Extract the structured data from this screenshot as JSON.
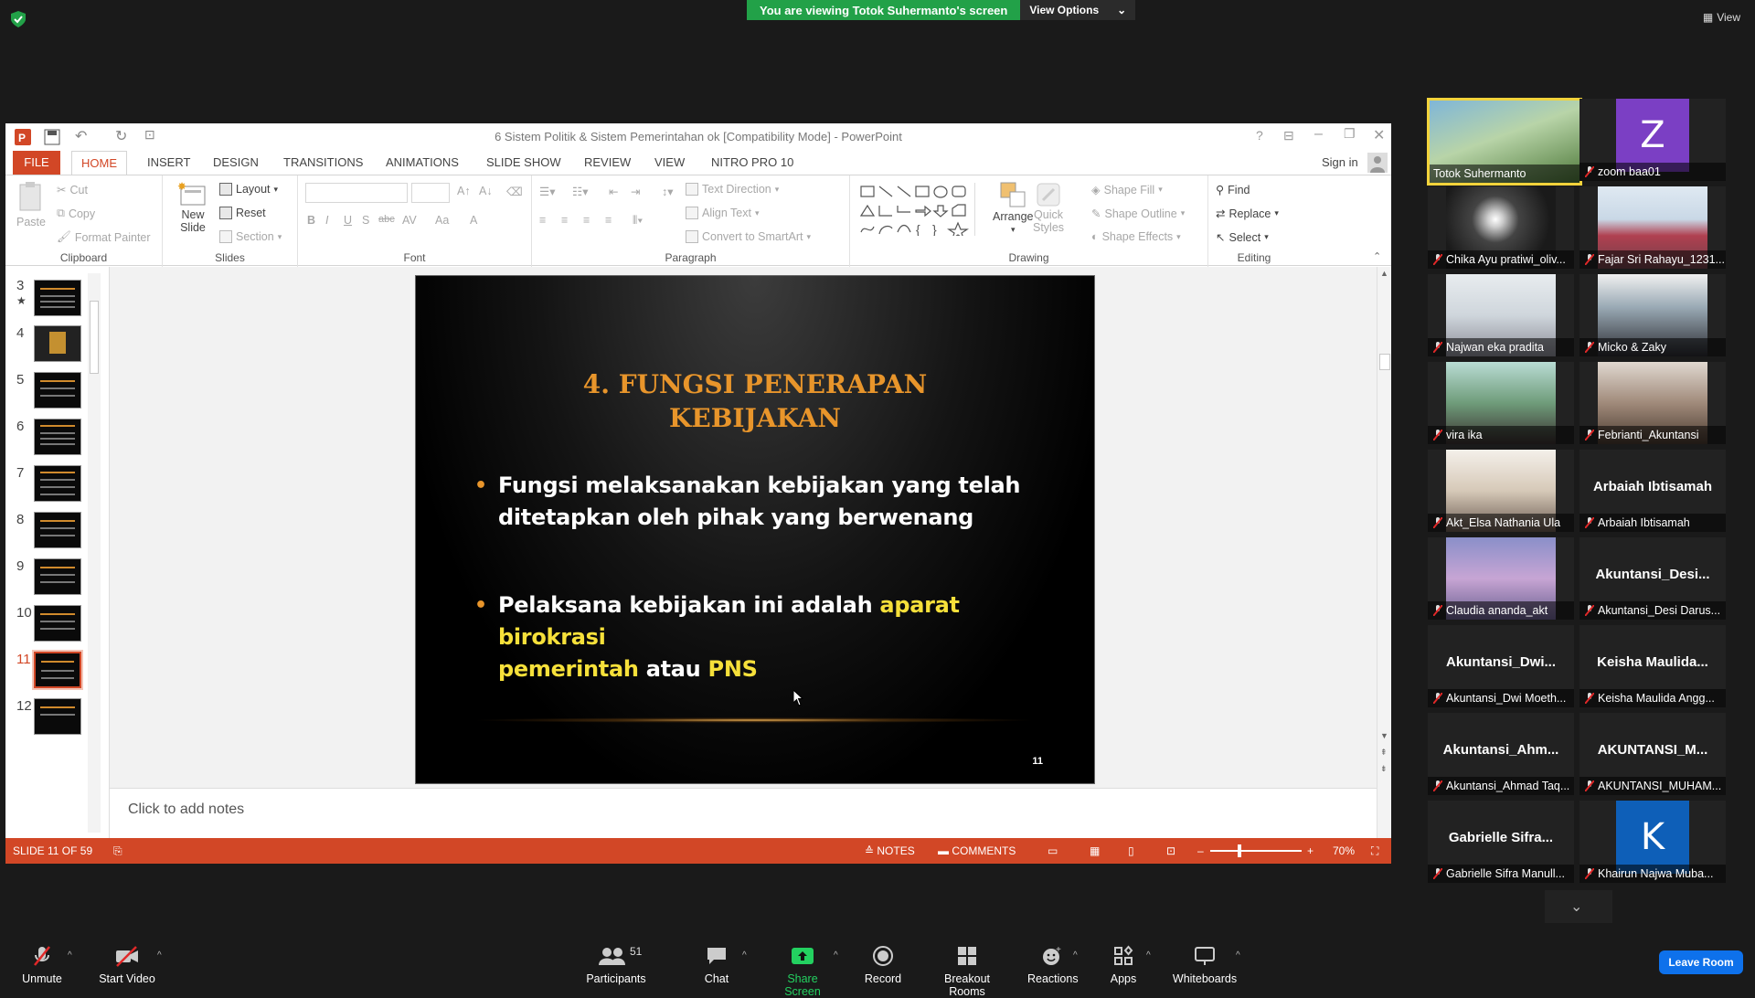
{
  "zoom_top": {
    "banner_text": "You are viewing Totok Suhermanto's screen",
    "view_options": "View Options",
    "view_label": "View"
  },
  "ppt": {
    "window_title": "6 Sistem Politik & Sistem Pemerintahan ok [Compatibility Mode] - PowerPoint",
    "sign_in": "Sign in",
    "tabs": [
      "FILE",
      "HOME",
      "INSERT",
      "DESIGN",
      "TRANSITIONS",
      "ANIMATIONS",
      "SLIDE SHOW",
      "REVIEW",
      "VIEW",
      "NITRO PRO 10"
    ],
    "ribbon": {
      "clipboard": {
        "paste": "Paste",
        "cut": "Cut",
        "copy": "Copy",
        "format_painter": "Format Painter",
        "label": "Clipboard"
      },
      "slides": {
        "new_slide": "New",
        "new_slide2": "Slide",
        "layout": "Layout",
        "reset": "Reset",
        "section": "Section",
        "label": "Slides"
      },
      "font": {
        "label": "Font",
        "bold": "B",
        "italic": "I",
        "underline": "U",
        "shadow": "S",
        "strike": "abc",
        "spacing": "AV",
        "case": "Aa",
        "color": "A"
      },
      "paragraph": {
        "text_direction": "Text Direction",
        "align_text": "Align Text",
        "convert": "Convert to SmartArt",
        "label": "Paragraph"
      },
      "drawing": {
        "arrange": "Arrange",
        "quick_styles": "Quick",
        "quick_styles2": "Styles",
        "shape_fill": "Shape Fill",
        "shape_outline": "Shape Outline",
        "shape_effects": "Shape Effects",
        "label": "Drawing"
      },
      "editing": {
        "find": "Find",
        "replace": "Replace",
        "select": "Select",
        "label": "Editing"
      }
    },
    "thumbnails": [
      "3",
      "4",
      "5",
      "6",
      "7",
      "8",
      "9",
      "10",
      "11",
      "12"
    ],
    "selected_slide": "11",
    "slide": {
      "title_line1": "4. FUNGSI PENERAPAN",
      "title_line2": "KEBIJAKAN",
      "bullet1_line1": "Fungsi melaksanakan kebijakan yang telah",
      "bullet1_line2": "ditetapkan oleh pihak yang berwenang",
      "bullet2_a": "Pelaksana kebijakan ini adalah ",
      "bullet2_b": "aparat birokrasi",
      "bullet2_c": "pemerintah",
      "bullet2_d": " atau ",
      "bullet2_e": "PNS",
      "number": "11"
    },
    "notes_placeholder": "Click to add notes",
    "status": {
      "slide_of": "SLIDE 11 OF 59",
      "notes": "NOTES",
      "comments": "COMMENTS",
      "zoom": "70%"
    }
  },
  "gallery": [
    {
      "name": "Totok Suhermanto",
      "type": "video"
    },
    {
      "name": "zoom baa01",
      "type": "avatar",
      "letter": "Z",
      "color": "#7b3fc4"
    },
    {
      "name": "Chika Ayu pratiwi_oliv...",
      "type": "video"
    },
    {
      "name": "Fajar Sri Rahayu_1231...",
      "type": "video"
    },
    {
      "name": "Najwan eka pradita",
      "type": "video"
    },
    {
      "name": "Micko & Zaky",
      "type": "video"
    },
    {
      "name": "vira ika",
      "type": "video"
    },
    {
      "name": "Febrianti_Akuntansi",
      "type": "video"
    },
    {
      "name": "Akt_Elsa Nathania Ula",
      "type": "video"
    },
    {
      "name": "Arbaiah Ibtisamah",
      "type": "name",
      "big": "Arbaiah Ibtisamah"
    },
    {
      "name": "Claudia ananda_akt",
      "type": "video"
    },
    {
      "name": "Akuntansi_Desi Darus...",
      "type": "name",
      "big": "Akuntansi_Desi..."
    },
    {
      "name": "Akuntansi_Dwi Moeth...",
      "type": "name",
      "big": "Akuntansi_Dwi..."
    },
    {
      "name": "Keisha Maulida Angg...",
      "type": "name",
      "big": "Keisha  Maulida..."
    },
    {
      "name": "Akuntansi_Ahmad Taq...",
      "type": "name",
      "big": "Akuntansi_Ahm..."
    },
    {
      "name": "AKUNTANSI_MUHAM...",
      "type": "name",
      "big": "AKUNTANSI_M..."
    },
    {
      "name": "Gabrielle Sifra Manull...",
      "type": "name",
      "big": "Gabrielle  Sifra..."
    },
    {
      "name": "Khairun Najwa Muba...",
      "type": "avatar",
      "letter": "K",
      "color": "#0e5fb8"
    }
  ],
  "toolbar": {
    "unmute": "Unmute",
    "start_video": "Start Video",
    "participants": "Participants",
    "participants_count": "51",
    "chat": "Chat",
    "share_screen": "Share Screen",
    "record": "Record",
    "breakout": "Breakout Rooms",
    "reactions": "Reactions",
    "apps": "Apps",
    "whiteboards": "Whiteboards",
    "leave": "Leave Room"
  }
}
